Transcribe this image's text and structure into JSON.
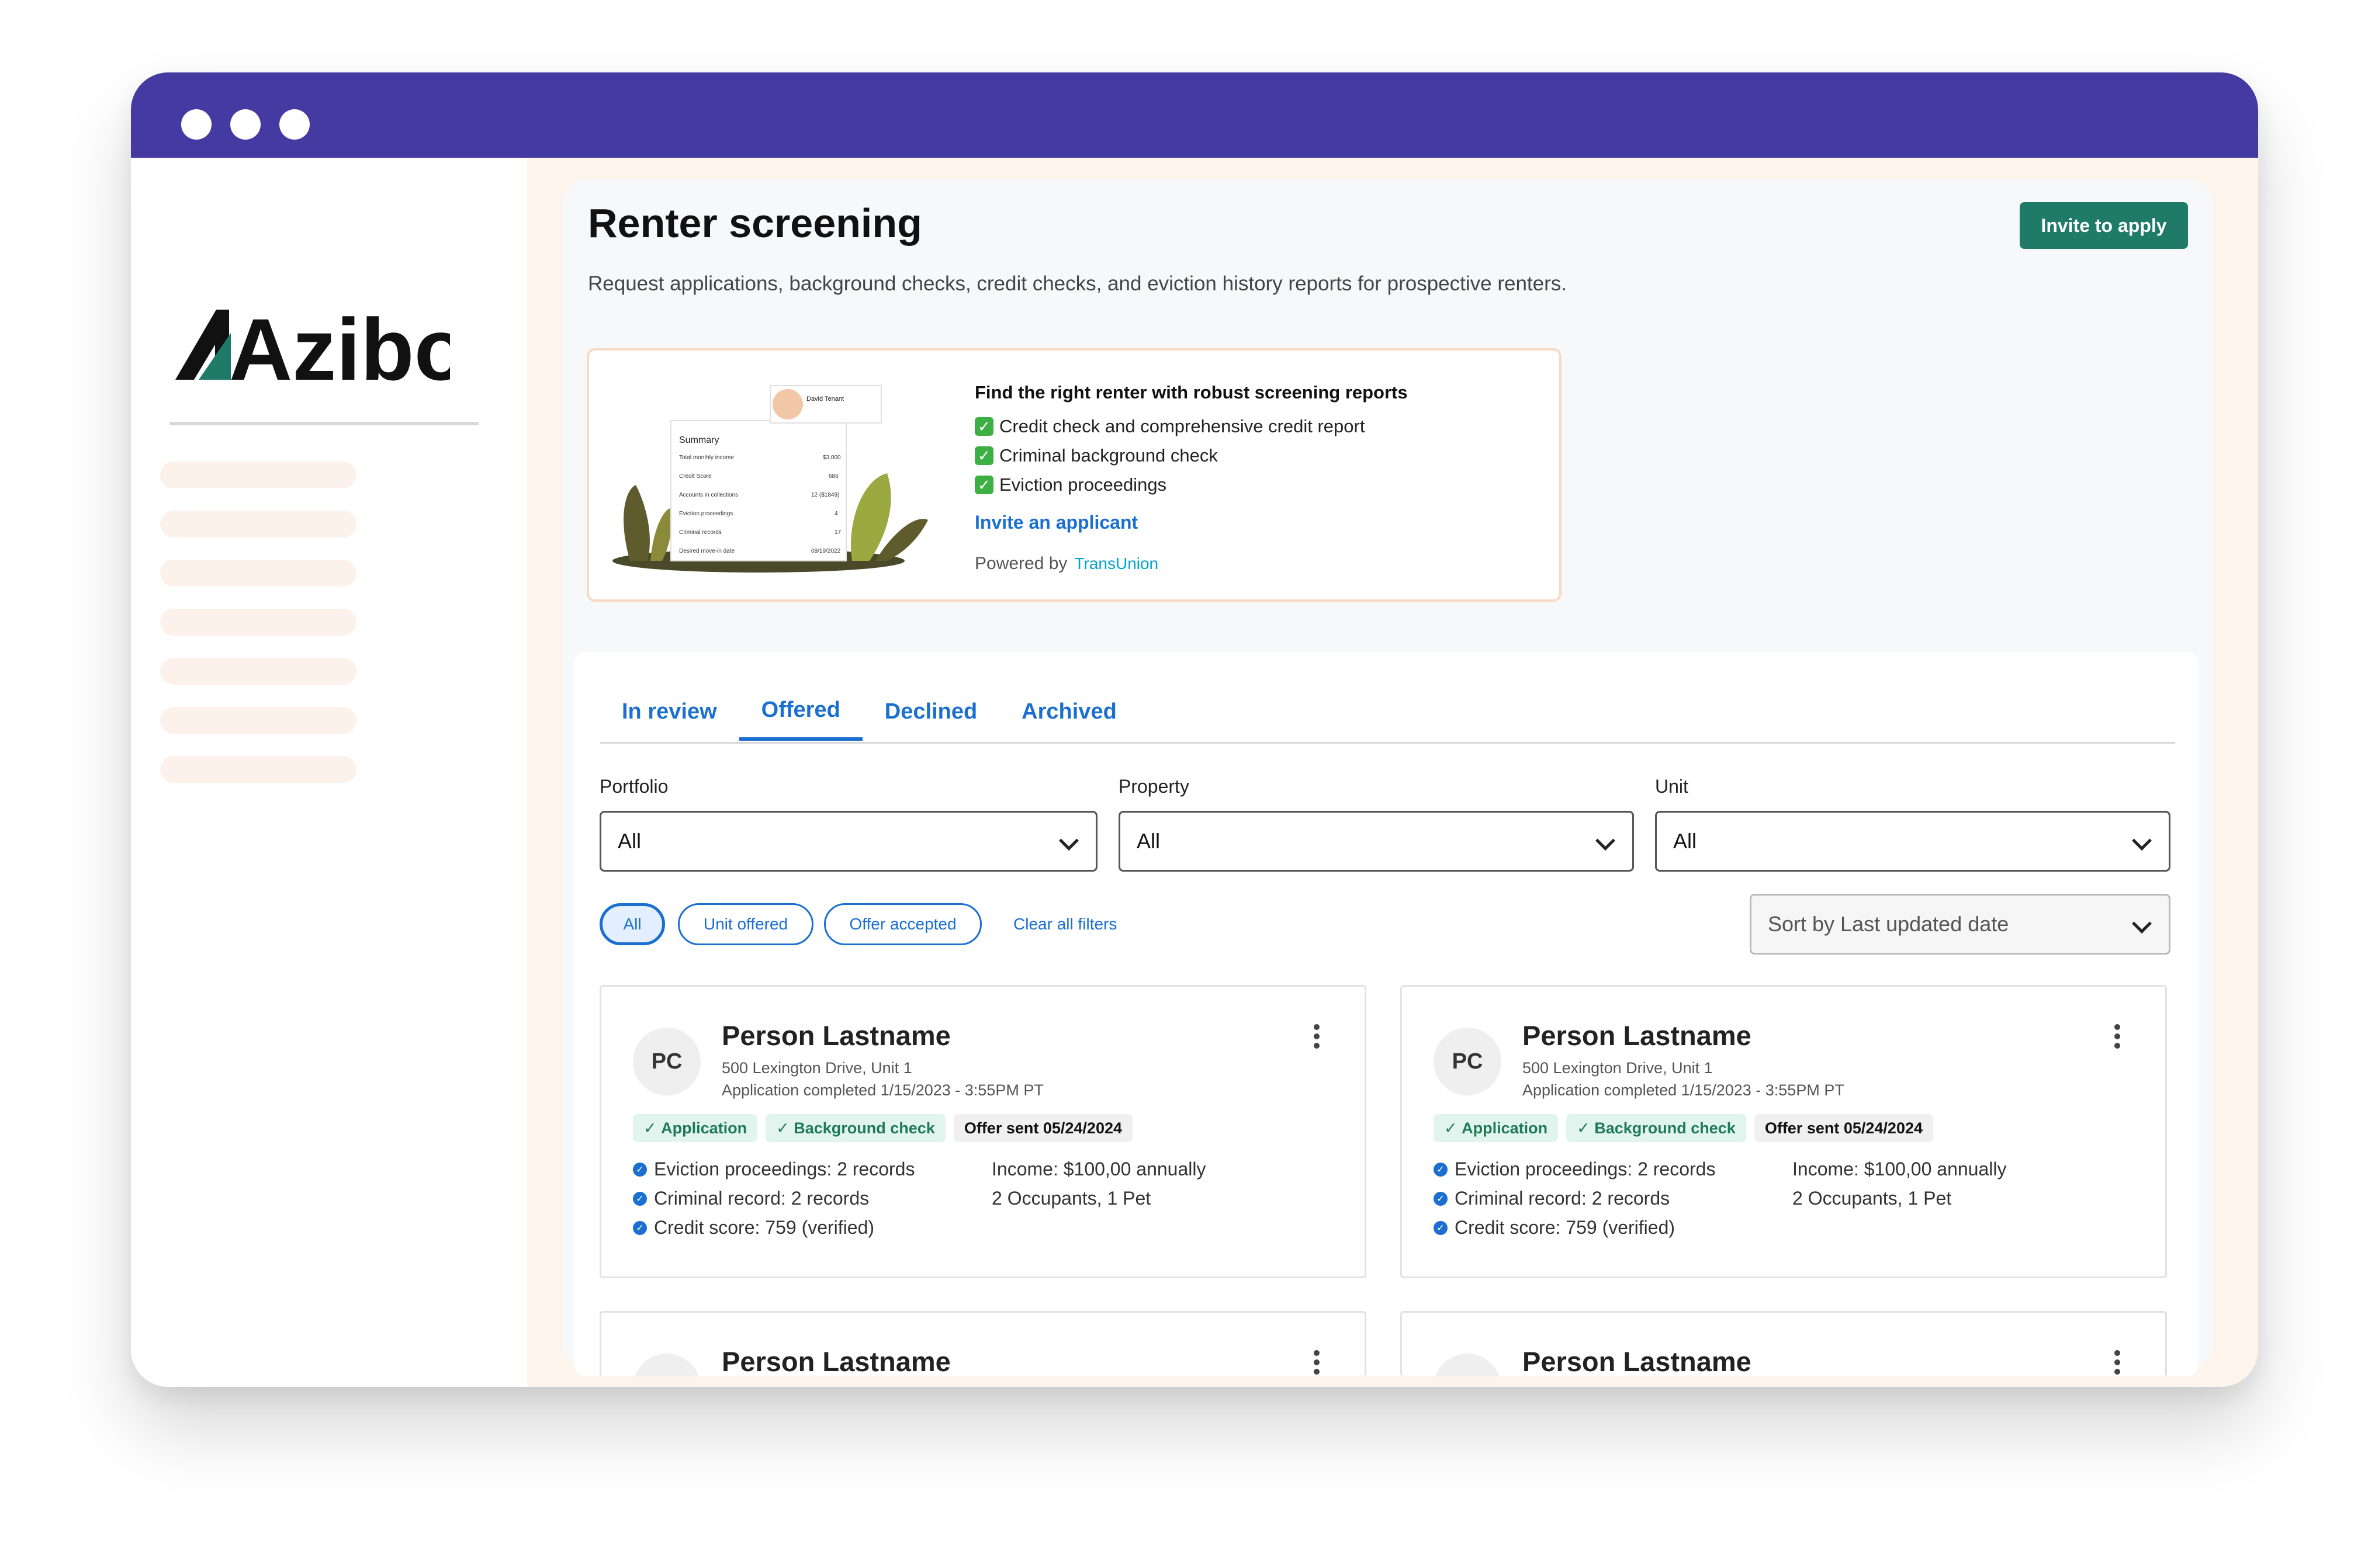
{
  "app": {
    "logo_text": "Azibo"
  },
  "header": {
    "title": "Renter screening",
    "subtitle": "Request applications, background checks, credit checks, and eviction history reports for prospective renters.",
    "invite_button": "Invite to apply"
  },
  "promo": {
    "title": "Find the right renter with robust screening reports",
    "items": [
      "Credit check and comprehensive credit report",
      "Criminal background check",
      "Eviction proceedings"
    ],
    "link": "Invite an applicant",
    "powered_by": "Powered by",
    "provider": "TransUnion",
    "illustration": {
      "tenant_name": "David Tenant",
      "summary_title": "Summary",
      "rows": [
        {
          "label": "Total monthly income",
          "value": "$3,000"
        },
        {
          "label": "Credit Score",
          "value": "686"
        },
        {
          "label": "Accounts in collections",
          "value": "12 ($1849)"
        },
        {
          "label": "Eviction proceedings",
          "value": "4"
        },
        {
          "label": "Criminal records",
          "value": "17"
        },
        {
          "label": "Desired move-in date",
          "value": "08/19/2022"
        }
      ]
    }
  },
  "tabs": [
    "In review",
    "Offered",
    "Declined",
    "Archived"
  ],
  "active_tab": "Offered",
  "filters": {
    "portfolio": {
      "label": "Portfolio",
      "value": "All"
    },
    "property": {
      "label": "Property",
      "value": "All"
    },
    "unit": {
      "label": "Unit",
      "value": "All"
    },
    "chips": [
      "All",
      "Unit offered",
      "Offer accepted"
    ],
    "clear": "Clear all filters",
    "sort": "Sort by Last updated date"
  },
  "cards": [
    {
      "initials": "PC",
      "name": "Person Lastname",
      "address": "500 Lexington Drive, Unit 1",
      "completed": "Application completed 1/15/2023 - 3:55PM PT",
      "badges": [
        "Application",
        "Background check"
      ],
      "offer": "Offer sent 05/24/2024",
      "eviction": "Eviction proceedings: 2 records",
      "criminal": "Criminal record:  2 records",
      "credit": "Credit score: 759 (verified)",
      "income": "Income:  $100,00 annually",
      "occupants": "2 Occupants, 1 Pet"
    },
    {
      "initials": "PC",
      "name": "Person Lastname",
      "address": "500 Lexington Drive, Unit 1",
      "completed": "Application completed 1/15/2023 - 3:55PM PT",
      "badges": [
        "Application",
        "Background check"
      ],
      "offer": "Offer sent 05/24/2024",
      "eviction": "Eviction proceedings: 2 records",
      "criminal": "Criminal record:  2 records",
      "credit": "Credit score: 759 (verified)",
      "income": "Income:  $100,00 annually",
      "occupants": "2 Occupants, 1 Pet"
    },
    {
      "name": "Person Lastname"
    },
    {
      "name": "Person Lastname"
    }
  ],
  "colors": {
    "titlebar": "#4539a2",
    "primary_button": "#1f7a68",
    "link": "#1a6fd0",
    "page_background": "#fdf4ec"
  }
}
